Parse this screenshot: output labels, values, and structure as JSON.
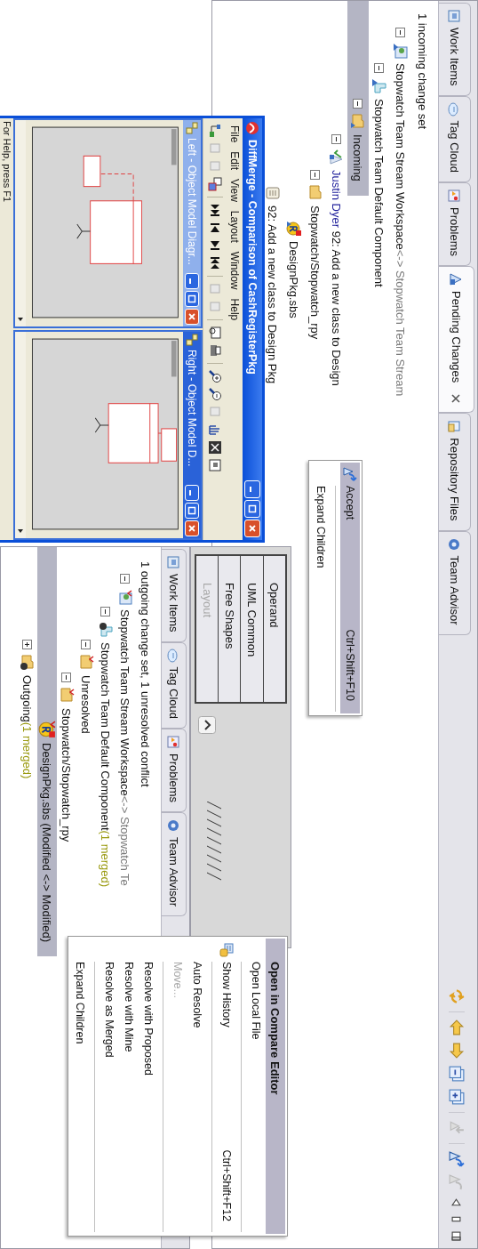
{
  "main_view": {
    "tabs": [
      {
        "kind": "work-items",
        "label": "Work Items",
        "selected": false,
        "closable": false
      },
      {
        "kind": "tag-cloud",
        "label": "Tag Cloud",
        "selected": false,
        "closable": false
      },
      {
        "kind": "problems",
        "label": "Problems",
        "selected": false,
        "closable": false
      },
      {
        "kind": "pending-changes",
        "label": "Pending Changes",
        "selected": true,
        "closable": true
      },
      {
        "kind": "repository-files",
        "label": "Repository Files",
        "selected": false,
        "closable": false
      },
      {
        "kind": "team-advisor",
        "label": "Team Advisor",
        "selected": false,
        "closable": false
      }
    ],
    "summary": "1 incoming change set",
    "tree": [
      {
        "kind": "workspace",
        "label": "Stopwatch Team Stream Workspace",
        "detail": "<-> Stopwatch Team Stream",
        "selected": false,
        "expanded": true,
        "children": [
          {
            "kind": "component",
            "label": "Stopwatch Team Default Component",
            "selected": false,
            "expanded": true,
            "children": [
              {
                "kind": "incoming",
                "label": "Incoming",
                "selected": true,
                "expanded": true,
                "children": [
                  {
                    "kind": "changeset",
                    "author": "Justin Dyer",
                    "label": "92: Add a new class to Design",
                    "selected": false,
                    "expanded": true,
                    "children": [
                      {
                        "kind": "folder",
                        "label": "Stopwatch/Stopwatch_rpy",
                        "selected": false,
                        "expanded": true,
                        "children": [
                          {
                            "kind": "file",
                            "label": "DesignPkg.sbs",
                            "selected": false
                          }
                        ]
                      },
                      {
                        "kind": "comment",
                        "label": "92: Add a new class to Design Pkg",
                        "selected": false
                      }
                    ]
                  }
                ]
              }
            ]
          }
        ]
      }
    ],
    "context_menu": [
      {
        "kind": "icon-item",
        "label": "Accept",
        "shortcut": "Ctrl+Shift+F10",
        "selected": true,
        "default": false,
        "disabled": false
      },
      {
        "kind": "separator"
      },
      {
        "kind": "item",
        "label": "Expand Children",
        "selected": false,
        "default": false,
        "disabled": false
      }
    ]
  },
  "diffmerge_window": {
    "title": "DiffMerge - Comparison of CashRegisterPkg",
    "menu": [
      "File",
      "Edit",
      "View",
      "Layout",
      "Window",
      "Help"
    ],
    "panes": [
      {
        "title": "Left - Object Model Diagr...",
        "active": false
      },
      {
        "title": "Right - Object Model D...",
        "active": true
      }
    ],
    "status_bar": "For Help, press F1"
  },
  "palette": {
    "items": [
      {
        "label": "Operand",
        "disabled": false
      },
      {
        "label": "UML Common",
        "disabled": false
      },
      {
        "label": "Free Shapes",
        "disabled": false
      },
      {
        "label": "Layout",
        "disabled": true
      }
    ]
  },
  "lower_view": {
    "tabs": [
      {
        "kind": "work-items",
        "label": "Work Items",
        "selected": false,
        "closable": false
      },
      {
        "kind": "tag-cloud",
        "label": "Tag Cloud",
        "selected": false,
        "closable": false
      },
      {
        "kind": "problems",
        "label": "Problems",
        "selected": false,
        "closable": false
      },
      {
        "kind": "team-advisor",
        "label": "Team Advisor",
        "selected": false,
        "closable": false
      }
    ],
    "summary": "1 outgoing change set, 1 unresolved conflict",
    "tree": [
      {
        "kind": "workspace-out",
        "label": "Stopwatch Team Stream Workspace",
        "detail": "<-> Stopwatch Te",
        "selected": false,
        "expanded": true,
        "children": [
          {
            "kind": "component-out",
            "label": "Stopwatch Team Default Component",
            "badge": "(1 merged)",
            "selected": false,
            "expanded": true,
            "children": [
              {
                "kind": "unresolved",
                "label": "Unresolved",
                "selected": false,
                "expanded": true,
                "children": [
                  {
                    "kind": "folder-out",
                    "label": "Stopwatch/Stopwatch_rpy",
                    "selected": false,
                    "expanded": true,
                    "children": [
                      {
                        "kind": "file-out",
                        "label": "DesignPkg.sbs (Modified <-> Modified)",
                        "selected": true
                      }
                    ]
                  }
                ]
              },
              {
                "kind": "outgoing",
                "label": "Outgoing",
                "badge": "(1 merged)",
                "selected": false,
                "expanded": false
              }
            ]
          }
        ]
      }
    ],
    "context_menu": [
      {
        "kind": "item",
        "label": "Open in Compare Editor",
        "selected": true,
        "default": true,
        "disabled": false
      },
      {
        "kind": "item",
        "label": "Open Local File",
        "selected": false,
        "default": false,
        "disabled": false
      },
      {
        "kind": "separator"
      },
      {
        "kind": "icon-item",
        "label": "Show History",
        "shortcut": "Ctrl+Shift+F12",
        "selected": false,
        "default": false,
        "disabled": false
      },
      {
        "kind": "separator"
      },
      {
        "kind": "item",
        "label": "Auto Resolve",
        "selected": false,
        "default": false,
        "disabled": false
      },
      {
        "kind": "item",
        "label": "Move...",
        "selected": false,
        "default": false,
        "disabled": true
      },
      {
        "kind": "separator"
      },
      {
        "kind": "item",
        "label": "Resolve with Proposed",
        "selected": false,
        "default": false,
        "disabled": false
      },
      {
        "kind": "item",
        "label": "Resolve with Mine",
        "selected": false,
        "default": false,
        "disabled": false
      },
      {
        "kind": "item",
        "label": "Resolve as Merged",
        "selected": false,
        "default": false,
        "disabled": false
      },
      {
        "kind": "separator"
      },
      {
        "kind": "item",
        "label": "Expand Children",
        "selected": false,
        "default": false,
        "disabled": false
      }
    ]
  }
}
